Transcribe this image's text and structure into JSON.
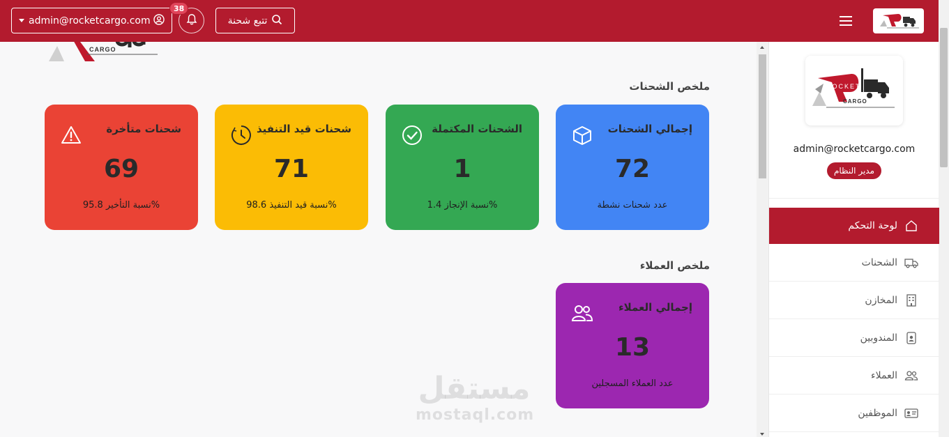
{
  "header": {
    "user_email": "admin@rocketcargo.com",
    "notification_count": "38",
    "track_label": "تتبع شحنة"
  },
  "sidebar": {
    "email": "admin@rocketcargo.com",
    "role": "مدير النظام",
    "items": [
      {
        "label": "لوحة التحكم",
        "icon": "home-icon",
        "active": true
      },
      {
        "label": "الشحنات",
        "icon": "truck-icon"
      },
      {
        "label": "المخازن",
        "icon": "building-icon"
      },
      {
        "label": "المندوبين",
        "icon": "person-badge-icon"
      },
      {
        "label": "العملاء",
        "icon": "people-icon"
      },
      {
        "label": "الموظفين",
        "icon": "id-card-icon"
      }
    ]
  },
  "logo": {
    "text_top": "ROCKET",
    "text_bottom": "CARGO"
  },
  "shipments": {
    "section_title": "ملخص الشحنات",
    "cards": [
      {
        "title": "إجمالي الشحنات",
        "value": "72",
        "sub": "عدد شحنات نشطة",
        "color": "#4285f4",
        "icon": "box-icon"
      },
      {
        "title": "الشحنات المكتملة",
        "value": "1",
        "sub": "نسبة الإنجاز 1.4%",
        "color": "#34a853",
        "icon": "check-circle-icon"
      },
      {
        "title": "شحنات قيد التنفيذ",
        "value": "71",
        "sub": "نسبة قيد التنفيذ 98.6%",
        "color": "#fbbc05",
        "icon": "clock-icon"
      },
      {
        "title": "شحنات متأخرة",
        "value": "69",
        "sub": "نسبة التأخير 95.8%",
        "color": "#ea4335",
        "icon": "warning-icon"
      }
    ]
  },
  "customers": {
    "section_title": "ملخص العملاء",
    "cards": [
      {
        "title": "إجمالي العملاء",
        "value": "13",
        "sub": "عدد العملاء المسجلين",
        "color": "#9c27b0",
        "icon": "people-icon"
      }
    ]
  },
  "watermark": {
    "arabic": "مستقل",
    "latin": "mostaql.com"
  }
}
